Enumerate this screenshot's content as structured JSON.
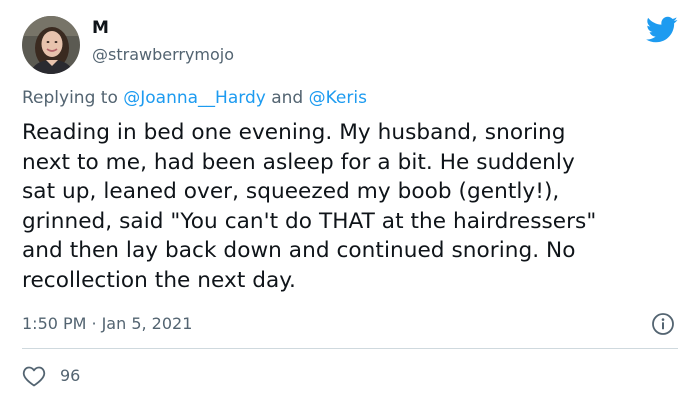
{
  "user": {
    "display_name": "M",
    "handle": "@strawberrymojo"
  },
  "reply": {
    "prefix": "Replying to ",
    "mention_1": "@Joanna__Hardy",
    "connector": " and ",
    "mention_2": "@Keris"
  },
  "tweet": {
    "text": "Reading in bed one evening. My husband, snoring\nnext to me, had been asleep for a bit. He suddenly\nsat up, leaned over, squeezed my boob (gently!),\ngrinned, said \"You can't do THAT at the hairdressers\"\nand then lay back down and continued snoring. No\nrecollection the next day."
  },
  "meta": {
    "time": "1:50 PM",
    "separator": "·",
    "date": "Jan 5, 2021"
  },
  "actions": {
    "like_count": "96"
  },
  "icons": {
    "brand": "twitter-bird-icon",
    "info": "info-icon",
    "like": "heart-icon"
  },
  "colors": {
    "brand_blue": "#1d9bf0",
    "text_primary": "#0f1419",
    "text_secondary": "#536471",
    "divider": "#cfd9de"
  }
}
